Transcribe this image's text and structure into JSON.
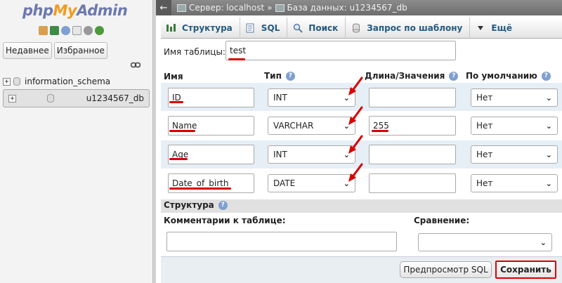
{
  "nav": {
    "logo": {
      "php": "php",
      "my": "My",
      "admin": "Admin"
    },
    "icons": [
      "home-icon",
      "exit-icon",
      "help-icon",
      "docs-icon",
      "settings-icon",
      "reload-icon"
    ],
    "buttons": {
      "recent": "Недавнее",
      "favorites": "Избранное"
    },
    "databases": [
      "information_schema",
      "u1234567_db"
    ]
  },
  "breadcrumb": {
    "server": "Сервер: localhost",
    "separator": "»",
    "database": "База данных: u1234567_db"
  },
  "tabs": [
    {
      "label": "Структура",
      "icon": "structure-icon"
    },
    {
      "label": "SQL",
      "icon": "sql-icon"
    },
    {
      "label": "Поиск",
      "icon": "search-icon"
    },
    {
      "label": "Запрос по шаблону",
      "icon": "query-icon"
    },
    {
      "label": "Ещё",
      "icon": "chevron-down-icon"
    }
  ],
  "form": {
    "table_name_label": "Имя таблицы:",
    "table_name": "test",
    "headers": {
      "name": "Имя",
      "type": "Тип",
      "length": "Длина/Значения",
      "default": "По умолчанию"
    },
    "columns": [
      {
        "name": "ID",
        "type": "INT",
        "length": "",
        "default": "Нет"
      },
      {
        "name": "Name",
        "type": "VARCHAR",
        "length": "255",
        "default": "Нет"
      },
      {
        "name": "Age",
        "type": "INT",
        "length": "",
        "default": "Нет"
      },
      {
        "name": "Date_of_birth",
        "type": "DATE",
        "length": "",
        "default": "Нет"
      }
    ],
    "structure_label": "Структура",
    "comments_label": "Комментарии к таблице:",
    "collation_label": "Сравнение:",
    "comments_value": "",
    "collation_value": "",
    "preview_sql_button": "Предпросмотр SQL",
    "save_button": "Сохранить"
  },
  "colors": {
    "annotation_red": "#d60000",
    "tab_text": "#235a81",
    "help_icon": "#7f9fd0"
  }
}
